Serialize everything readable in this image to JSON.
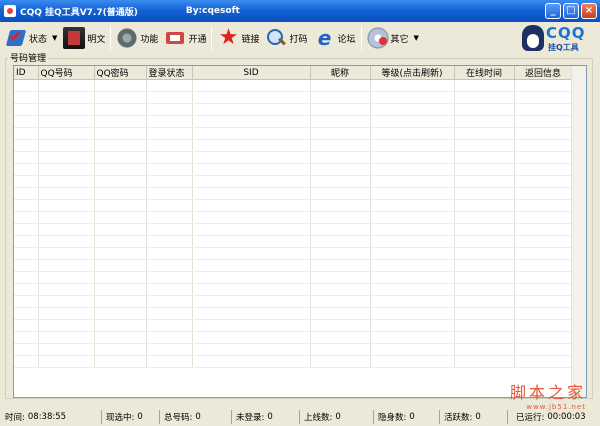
{
  "window": {
    "title": "CQQ 挂Q工具V7.7(普通版)",
    "author": "By:cqesoft",
    "btn_minimize": "_",
    "btn_maximize": "□",
    "btn_close": "×"
  },
  "toolbar": {
    "items": [
      {
        "label": "状态",
        "icon": "status-icon"
      },
      {
        "label": "明文",
        "icon": "plaintext-icon"
      },
      {
        "label": "功能",
        "icon": "gear-icon"
      },
      {
        "label": "开通",
        "icon": "open-icon"
      },
      {
        "label": "链接",
        "icon": "star-icon"
      },
      {
        "label": "打码",
        "icon": "magnifier-icon"
      },
      {
        "label": "论坛",
        "icon": "ie-icon"
      },
      {
        "label": "其它",
        "icon": "cd-icon"
      }
    ],
    "arrow": "▼"
  },
  "logo": {
    "title": "CQQ",
    "subtitle": "挂Q工具"
  },
  "group": {
    "title": "号码管理"
  },
  "table": {
    "columns": [
      "ID",
      "QQ号码",
      "QQ密码",
      "登录状态",
      "SID",
      "昵称",
      "等级(点击刷新)",
      "在线时间",
      "返回信息"
    ]
  },
  "statusbar": {
    "time_label": "时间:",
    "time_value": "08:38:55",
    "selected_label": "现选中:",
    "selected_value": "0",
    "total_label": "总号码:",
    "total_value": "0",
    "notlogged_label": "未登录:",
    "notlogged_value": "0",
    "online_label": "上线数:",
    "online_value": "0",
    "hidden_label": "隐身数:",
    "hidden_value": "0",
    "active_label": "活跃数:",
    "active_value": "0",
    "run_label": "已运行:",
    "run_value": "00:00:03"
  },
  "watermark": {
    "text": "脚本之家",
    "url": "www.jb51.net"
  }
}
